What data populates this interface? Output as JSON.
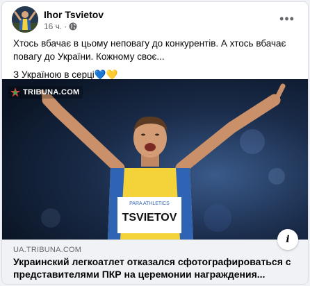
{
  "post": {
    "author": "Ihor Tsvietov",
    "time": "16 ч.",
    "privacy_icon": "public-globe-icon",
    "text_line1": "Хтось вбачає в цьому неповагу до конкурентів. А хтось вбачає повагу до України. Кожному своє...",
    "text_line2": "З Україною в серці💙💛"
  },
  "media": {
    "watermark": "TRIBUNA.COM",
    "bib_name": "TSVIETOV",
    "bib_top": "PARA ATHLETICS"
  },
  "link": {
    "domain": "UA.TRIBUNA.COM",
    "title": "Украинский легкоатлет отказался сфотографироваться с представителями ПКР на церемонии награждения...",
    "info": "i"
  },
  "colors": {
    "ukraine_blue": "#2f63b4",
    "ukraine_yellow": "#f3d23a",
    "text": "#050505",
    "muted": "#65676b"
  }
}
